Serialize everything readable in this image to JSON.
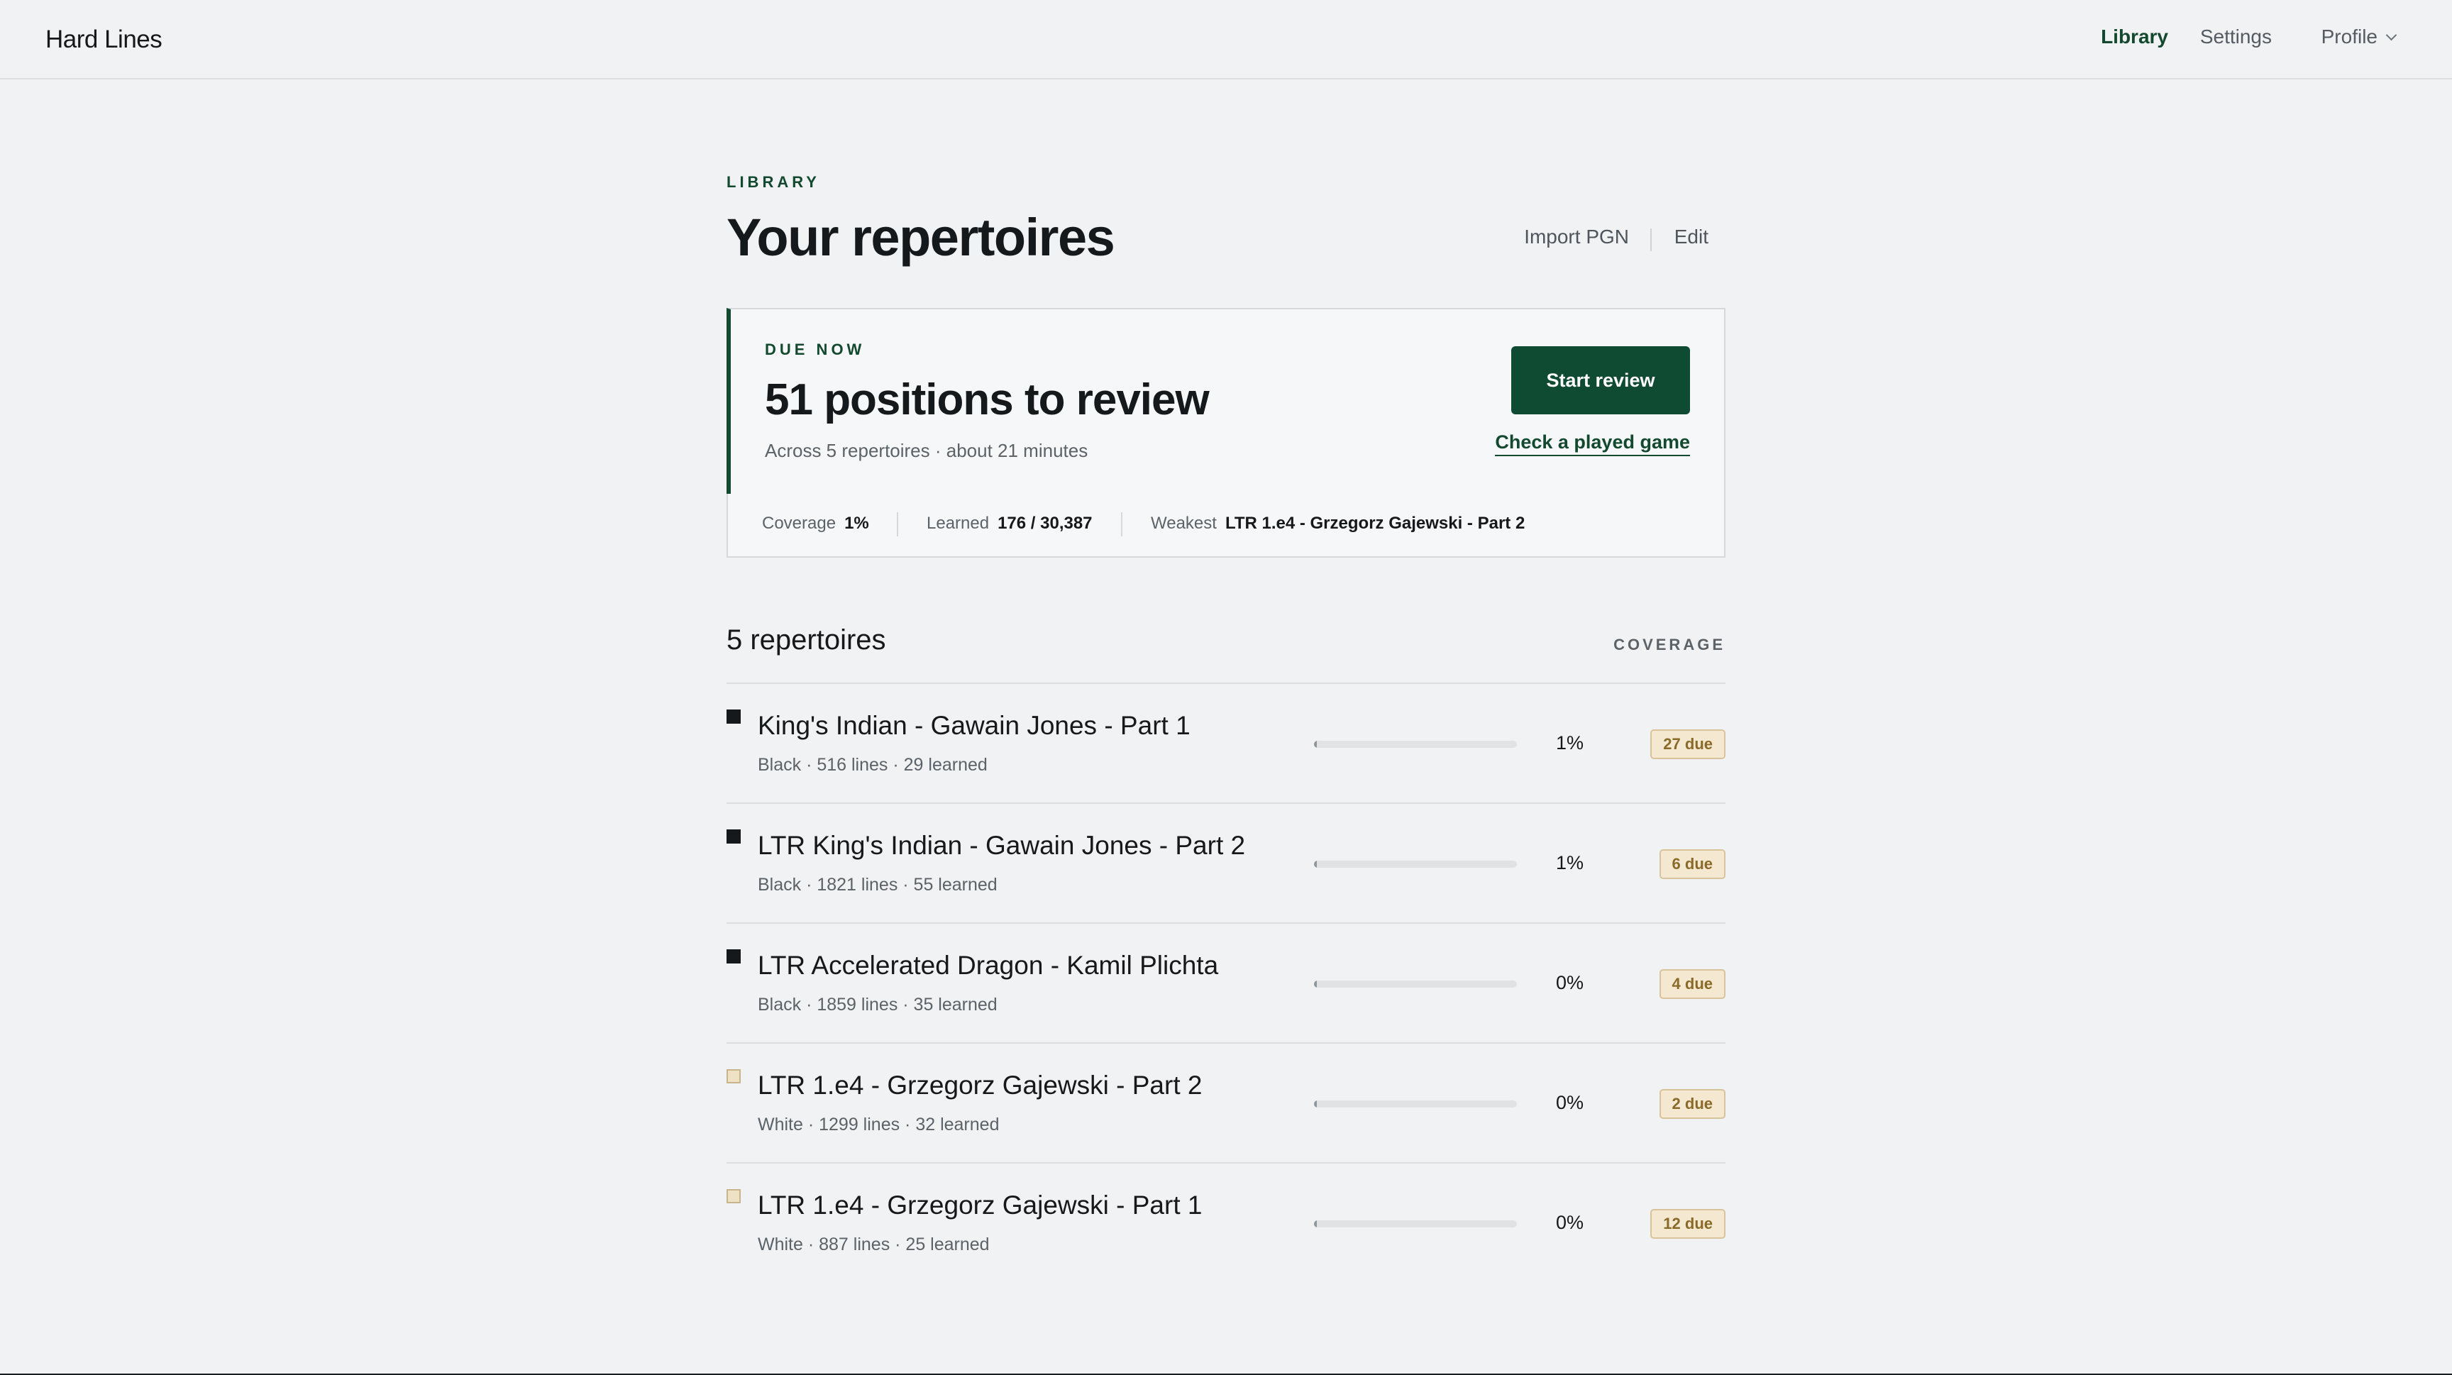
{
  "app": {
    "brand": "Hard Lines"
  },
  "nav": {
    "library": "Library",
    "settings": "Settings",
    "profile": "Profile"
  },
  "page": {
    "eyebrow": "LIBRARY",
    "title": "Your repertoires",
    "actions": {
      "import": "Import PGN",
      "edit": "Edit"
    }
  },
  "due": {
    "eyebrow": "DUE NOW",
    "title": "51 positions to review",
    "subtitle": "Across 5 repertoires · about 21 minutes",
    "start_label": "Start review",
    "check_label": "Check a played game"
  },
  "stats": {
    "coverage_label": "Coverage",
    "coverage_value": "1%",
    "learned_label": "Learned",
    "learned_value": "176 / 30,387",
    "weakest_label": "Weakest",
    "weakest_value": "LTR 1.e4 - Grzegorz Gajewski - Part 2"
  },
  "list": {
    "heading": "5 repertoires",
    "column": "COVERAGE",
    "items": [
      {
        "color": "black",
        "title": "King's Indian - Gawain Jones - Part 1",
        "meta": "Black · 516 lines · 29 learned",
        "coverage": 1,
        "coverage_label": "1%",
        "due": "27 due"
      },
      {
        "color": "black",
        "title": "LTR King's Indian - Gawain Jones - Part 2",
        "meta": "Black · 1821 lines · 55 learned",
        "coverage": 1,
        "coverage_label": "1%",
        "due": "6 due"
      },
      {
        "color": "black",
        "title": "LTR Accelerated Dragon - Kamil Plichta",
        "meta": "Black · 1859 lines · 35 learned",
        "coverage": 0,
        "coverage_label": "0%",
        "due": "4 due"
      },
      {
        "color": "white",
        "title": "LTR 1.e4 - Grzegorz Gajewski - Part 2",
        "meta": "White · 1299 lines · 32 learned",
        "coverage": 0,
        "coverage_label": "0%",
        "due": "2 due"
      },
      {
        "color": "white",
        "title": "LTR 1.e4 - Grzegorz Gajewski - Part 1",
        "meta": "White · 887 lines · 25 learned",
        "coverage": 0,
        "coverage_label": "0%",
        "due": "12 due"
      }
    ]
  }
}
